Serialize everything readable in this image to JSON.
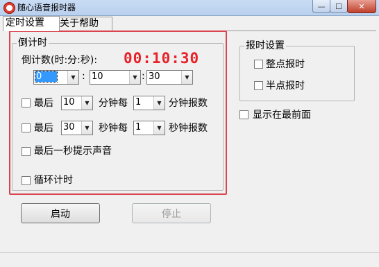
{
  "window": {
    "title": "随心语音报时器",
    "minimize_glyph": "—",
    "maximize_glyph": "☐",
    "close_glyph": "✕"
  },
  "tabs": [
    {
      "label": "定时设置",
      "active": true
    },
    {
      "label": "关于帮助",
      "active": false
    }
  ],
  "countdown": {
    "group_title": "倒计时",
    "label": "倒计数(时:分:秒):",
    "display": "00:10:30",
    "hours": "0",
    "minutes": "10",
    "seconds": "30",
    "separator": ":"
  },
  "minute_report": {
    "prefix": "最后",
    "value": "10",
    "mid": "分钟每",
    "interval": "1",
    "suffix": "分钟报数",
    "checked": false
  },
  "second_report": {
    "prefix": "最后",
    "value": "30",
    "mid": "秒钟每",
    "interval": "1",
    "suffix": "秒钟报数",
    "checked": false
  },
  "last_second_sound": {
    "label": "最后一秒提示声音",
    "checked": false
  },
  "loop": {
    "label": "循环计时",
    "checked": false
  },
  "report_settings": {
    "group_title": "报时设置",
    "on_hour": {
      "label": "整点报时",
      "checked": false
    },
    "half_hour": {
      "label": "半点报时",
      "checked": false
    }
  },
  "always_on_top": {
    "label": "显示在最前面",
    "checked": false
  },
  "buttons": {
    "start": "启动",
    "stop": "停止"
  },
  "colors": {
    "accent_red": "#e8212a",
    "highlight_border": "#d9444f",
    "selection_blue": "#3399ff"
  }
}
